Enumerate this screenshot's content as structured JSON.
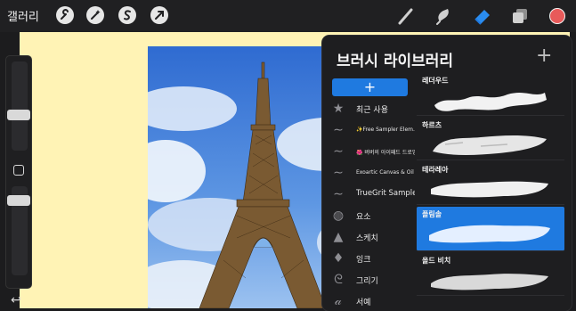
{
  "toolbar": {
    "gallery_label": "갤러리",
    "left_tools": [
      "wrench-icon",
      "magic-wand-icon",
      "selection-icon",
      "transform-arrow-icon"
    ],
    "right_tools": [
      "brush-icon",
      "smudge-icon",
      "eraser-icon",
      "layers-icon"
    ],
    "active_tool": "eraser-icon",
    "color": "#e85a5a"
  },
  "canvas": {
    "background": "#fff3b5"
  },
  "panel": {
    "title": "브러시 라이브러리",
    "add_symbol": "+",
    "new_set_symbol": "+",
    "categories": [
      {
        "label": "최근 사용",
        "icon": "star-icon"
      },
      {
        "label": "✨Free Sampler Elem...",
        "icon": "brush-stroke-icon"
      },
      {
        "label": "🌺 버버의 아이패드 드로잉",
        "icon": "brush-stroke-icon"
      },
      {
        "label": "Exoartic Canvas & Oil",
        "icon": "brush-stroke-icon"
      },
      {
        "label": "TrueGrit Sampler",
        "icon": "brush-stroke-icon"
      },
      {
        "label": "요소",
        "icon": "globe-icon"
      },
      {
        "label": "스케치",
        "icon": "pencil-tip-icon"
      },
      {
        "label": "잉크",
        "icon": "ink-drop-icon"
      },
      {
        "label": "그리기",
        "icon": "swirl-icon"
      },
      {
        "label": "서예",
        "icon": "calligraphy-icon"
      }
    ],
    "brushes": [
      {
        "name": "레더우드",
        "selected": false
      },
      {
        "name": "하르츠",
        "selected": false
      },
      {
        "name": "테라레아",
        "selected": false
      },
      {
        "name": "플림솔",
        "selected": true
      },
      {
        "name": "올드 비치",
        "selected": false
      }
    ]
  }
}
